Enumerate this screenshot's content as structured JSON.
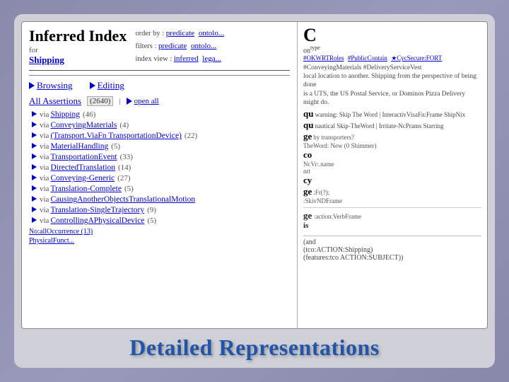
{
  "window": {
    "title": "Inferred Index",
    "for_label": "for",
    "shipping_link": "Shipping"
  },
  "header": {
    "order_by_label": "order by :",
    "order_by_links": [
      "predicate",
      "ontolo..."
    ],
    "filters_label": "filters :",
    "filters_links": [
      "predicate",
      "ontolo..."
    ],
    "index_view_label": "index view :",
    "index_view_links": [
      "inferred",
      "lega..."
    ]
  },
  "nav": {
    "browsing_label": "Browsing",
    "editing_label": "Editing"
  },
  "assertions": {
    "label": "All Assertions",
    "count": "(2640)",
    "open_all": "open all",
    "items": [
      {
        "label": "Shipping",
        "count": "(46)"
      },
      {
        "label": "ConveyingMaterials",
        "count": "(4)"
      },
      {
        "label": "(Transport.ViaFn TransportationDevice)",
        "count": "(22)"
      },
      {
        "label": "MaterialHandling",
        "count": "(5)"
      },
      {
        "label": "TransportationEvent",
        "count": "(33)"
      },
      {
        "label": "DirectedTranslation",
        "count": "(14)"
      },
      {
        "label": "Conveying-Generic",
        "count": "(27)"
      },
      {
        "label": "Translation-Complete",
        "count": "(5)"
      },
      {
        "label": "CausingAnotherObjectsTranslationalMotion",
        "count": ""
      },
      {
        "label": "Translation-SingleTrajectory",
        "count": "(9)"
      },
      {
        "label": "ControllingAPhysicalDevice",
        "count": "(5)"
      }
    ]
  },
  "right_panel": {
    "big_letter": "C",
    "superscript": "type",
    "on_text": "on",
    "links": [
      "#OKWRTRoles",
      "#PublicContain",
      "#CycSecure:FORT"
    ],
    "description_text": "#ConveyingMaterials #DeliveryServiceVest",
    "desc2": "local location to another. Shipping from the perspective of being done",
    "desc3": "is a UTS, the US Postal Service, or Dominos Pizza Delivery might do.",
    "qu1": "qu",
    "qu2": "qu",
    "qu_detail": "warning: Skip The Word | InteractivVisaFn:Frame ShipNix",
    "ge1": "ge",
    "co1": "co",
    "cy1": "cy",
    "ge2": "ge",
    "ge3_text": "ge",
    "in_text": "is",
    "bottom_texts": [
      "(and",
      "(tco:ACTION:Shipping)",
      "(features:tco ACTION:SUBJECT))"
    ]
  },
  "footer": {
    "title": "Detailed Representations"
  }
}
